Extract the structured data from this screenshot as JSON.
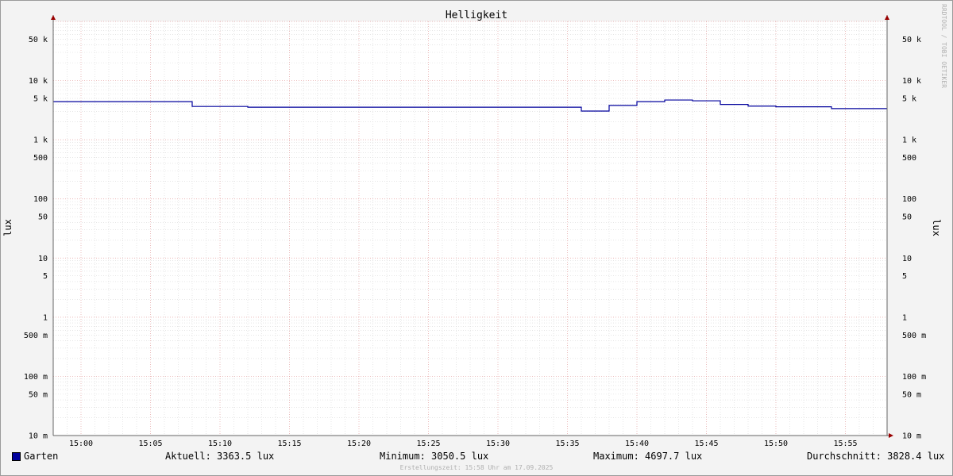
{
  "chart_data": {
    "type": "line",
    "title": "Helligkeit",
    "ylabel": "lux",
    "yscale": "log",
    "ylim": [
      0.01,
      100000
    ],
    "y_ticks": [
      {
        "value": 50000,
        "label": "50 k"
      },
      {
        "value": 10000,
        "label": "10 k"
      },
      {
        "value": 5000,
        "label": "5 k"
      },
      {
        "value": 1000,
        "label": "1 k"
      },
      {
        "value": 500,
        "label": "500"
      },
      {
        "value": 100,
        "label": "100"
      },
      {
        "value": 50,
        "label": "50"
      },
      {
        "value": 10,
        "label": "10"
      },
      {
        "value": 5,
        "label": "5"
      },
      {
        "value": 1,
        "label": "1"
      },
      {
        "value": 0.5,
        "label": "500 m"
      },
      {
        "value": 0.1,
        "label": "100 m"
      },
      {
        "value": 0.05,
        "label": "50 m"
      },
      {
        "value": 0.01,
        "label": "10 m"
      }
    ],
    "x_ticks": [
      "15:00",
      "15:05",
      "15:10",
      "15:15",
      "15:20",
      "15:25",
      "15:30",
      "15:35",
      "15:40",
      "15:45",
      "15:50",
      "15:55"
    ],
    "xlim": [
      "14:58",
      "15:58"
    ],
    "grid": true,
    "series": [
      {
        "name": "Garten",
        "color": "#00009c",
        "x": [
          "14:58",
          "15:08",
          "15:12",
          "15:36",
          "15:38",
          "15:40",
          "15:42",
          "15:44",
          "15:46",
          "15:48",
          "15:50",
          "15:54",
          "15:58"
        ],
        "values": [
          4400,
          3650,
          3550,
          3050.5,
          3800,
          4400,
          4697.7,
          4550,
          3950,
          3700,
          3600,
          3363.5,
          3363.5
        ]
      }
    ],
    "watermark": "RRDTOOL / TOBI OETIKER"
  },
  "legend": {
    "series_name": "Garten",
    "aktuell": "Aktuell: 3363.5 lux",
    "minimum": "Minimum: 3050.5 lux",
    "maximum": "Maximum: 4697.7 lux",
    "durchschnitt": "Durchschnitt: 3828.4 lux"
  },
  "footer": "Erstellungszeit: 15:58 Uhr am 17.09.2025"
}
